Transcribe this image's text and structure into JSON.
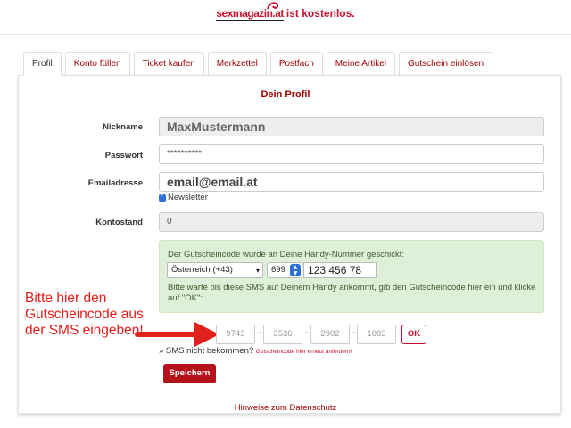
{
  "logo": {
    "brand": "sexmagazin.at",
    "tagline": "ist kostenlos."
  },
  "tabs": [
    {
      "label": "Profil",
      "active": true
    },
    {
      "label": "Konto füllen"
    },
    {
      "label": "Ticket kaufen"
    },
    {
      "label": "Merkzettel"
    },
    {
      "label": "Postfach"
    },
    {
      "label": "Meine Artikel"
    },
    {
      "label": "Gutschein einlösen"
    }
  ],
  "form": {
    "title": "Dein Profil",
    "nickname": {
      "label": "Nickname",
      "value": "MaxMustermann"
    },
    "password": {
      "label": "Passwort",
      "value": "**********"
    },
    "email": {
      "label": "Emailadresse",
      "value": "email@email.at",
      "newsletter_label": "Newsletter"
    },
    "balance": {
      "label": "Kontostand",
      "value": "0"
    }
  },
  "voucher": {
    "sent_text": "Der Gutscheincode wurde an Deine Handy-Nummer geschickt:",
    "country": "Österreich (+43)",
    "prefix": "699",
    "phone": "123 456 78",
    "wait_text": "Bitte warte bis diese SMS auf Deinem Handy ankommt, gib den Gutscheincode hier ein und klicke auf \"OK\":",
    "code_placeholders": [
      "9743",
      "3536",
      "2902",
      "1083"
    ],
    "ok_label": "OK",
    "sms_missing": "» SMS nicht bekommen?",
    "resend_link": "Gutscheincode hier erneut anfordern!"
  },
  "annotation": {
    "text": "Bitte hier den Gutscheincode aus der SMS eingeben!",
    "color": "#e0201a"
  },
  "save_label": "Speichern",
  "privacy_link": "Hinweise zum Datenschutz",
  "colors": {
    "accent": "#a00000",
    "button": "#b3121a",
    "success_bg": "#dff0d8"
  }
}
